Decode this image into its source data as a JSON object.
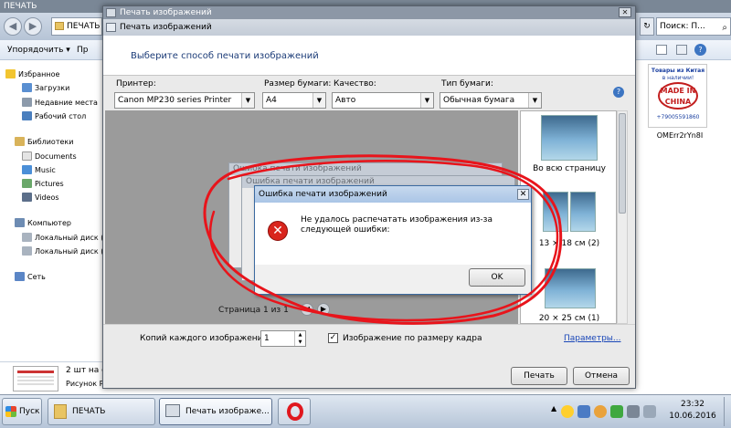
{
  "explorer": {
    "title": "ПЕЧАТЬ",
    "address": "ПЕЧАТЬ",
    "search_placeholder": "Поиск: П...",
    "toolbar": {
      "organize": "Упорядочить ▾",
      "next": "Пр"
    },
    "nav": {
      "favorites": "Избранное",
      "downloads": "Загрузки",
      "recent": "Недавние места",
      "desktop": "Рабочий стол",
      "libraries": "Библиотеки",
      "documents": "Documents",
      "music": "Music",
      "pictures": "Pictures",
      "videos": "Videos",
      "computer": "Компьютер",
      "disk1": "Локальный диск (",
      "disk2": "Локальный диск (",
      "network": "Сеть"
    },
    "details": {
      "count": "2 шт на с",
      "type": "Рисунок Р"
    },
    "file_thumb": {
      "name": "OMErr2rYn8I",
      "ad_line1": "Товары из Китая",
      "ad_line2": "в наличии!",
      "ad_badge": "MADE IN CHINA",
      "ad_phone": "+79005591860"
    }
  },
  "print": {
    "title": "Печать изображений",
    "subtitle": "Печать изображений",
    "heading": "Выберите способ печати изображений",
    "printer_label": "Принтер:",
    "printer_value": "Canon MP230 series Printer",
    "paper_label": "Размер бумаги:",
    "paper_value": "A4",
    "quality_label": "Качество:",
    "quality_value": "Авто",
    "type_label": "Тип бумаги:",
    "type_value": "Обычная бумага",
    "help": "?",
    "page_info": "Страница 1 из 1",
    "layouts": [
      {
        "label": "Во всю страницу"
      },
      {
        "label": "13 × 18 см (2)"
      },
      {
        "label": "20 × 25 см (1)"
      }
    ],
    "copies_label": "Копий каждого изображения:",
    "copies_value": "1",
    "fit_label": "Изображение по размеру кадра",
    "options_link": "Параметры...",
    "print_button": "Печать",
    "cancel_button": "Отмена"
  },
  "error": {
    "ghost_title": "Ошибка печати изображений",
    "title": "Ошибка печати изображений",
    "message": "Не удалось распечатать изображения из-за следующей ошибки:",
    "ok_button": "OK"
  },
  "taskbar": {
    "start": "Пуск",
    "items": [
      {
        "label": "ПЕЧАТЬ"
      },
      {
        "label": "Печать изображе..."
      }
    ],
    "time": "23:32",
    "date": "10.06.2016"
  },
  "colors": {
    "scribble": "#e8141b",
    "error_icon": "#d9251d",
    "link": "#1a47b8"
  }
}
